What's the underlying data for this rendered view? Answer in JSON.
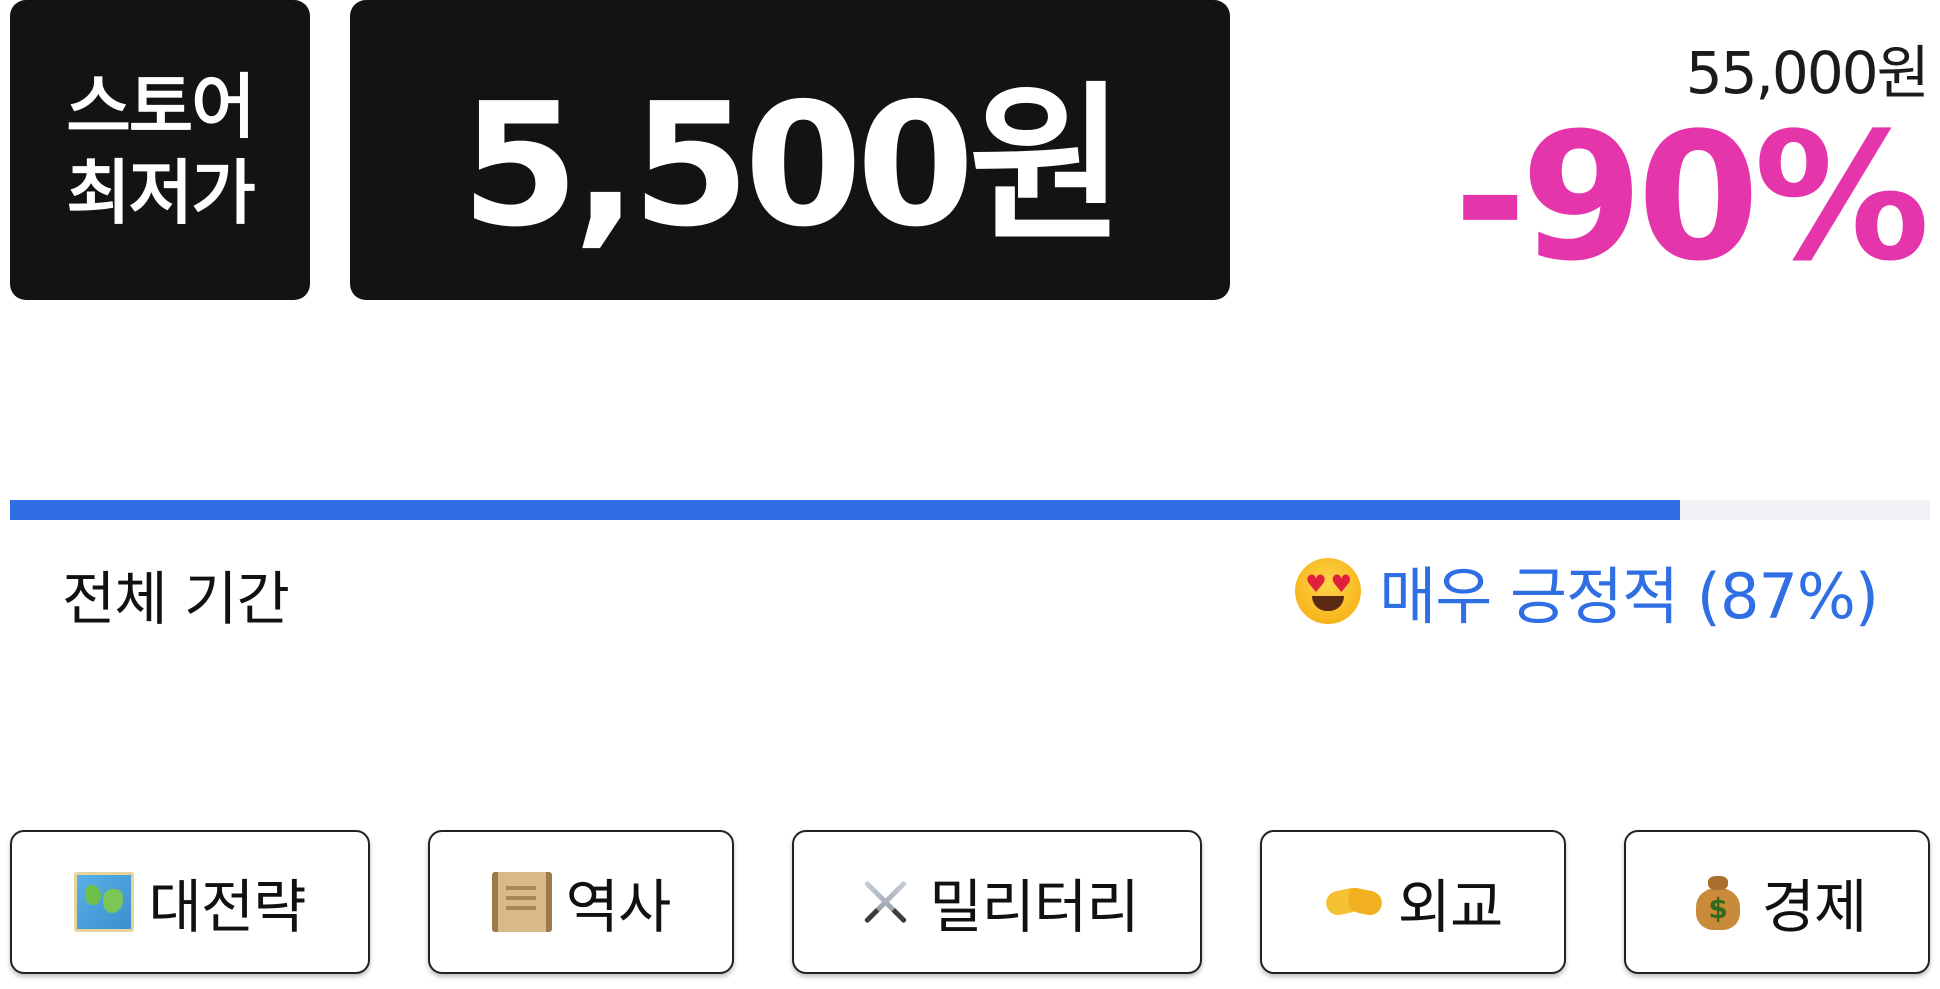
{
  "price_header": {
    "store_badge_line1": "스토어",
    "store_badge_line2": "최저가",
    "current_price": "5,500원",
    "original_price": "55,000원",
    "discount": "-90%"
  },
  "reviews": {
    "positive_ratio": 0.87,
    "period_label": "전체 기간",
    "summary_icon": "heart-eyes-emoji",
    "summary_text": "매우 긍정적 (87%)"
  },
  "tags": [
    {
      "icon": "world-map-icon",
      "label": "대전략"
    },
    {
      "icon": "scroll-icon",
      "label": "역사"
    },
    {
      "icon": "crossed-swords-icon",
      "label": "밀리터리"
    },
    {
      "icon": "handshake-icon",
      "label": "외교"
    },
    {
      "icon": "money-bag-icon",
      "label": "경제"
    }
  ],
  "colors": {
    "dark_box": "#131313",
    "discount": "#e535ab",
    "accent_blue": "#306fe3",
    "track": "#f1f2f6"
  }
}
